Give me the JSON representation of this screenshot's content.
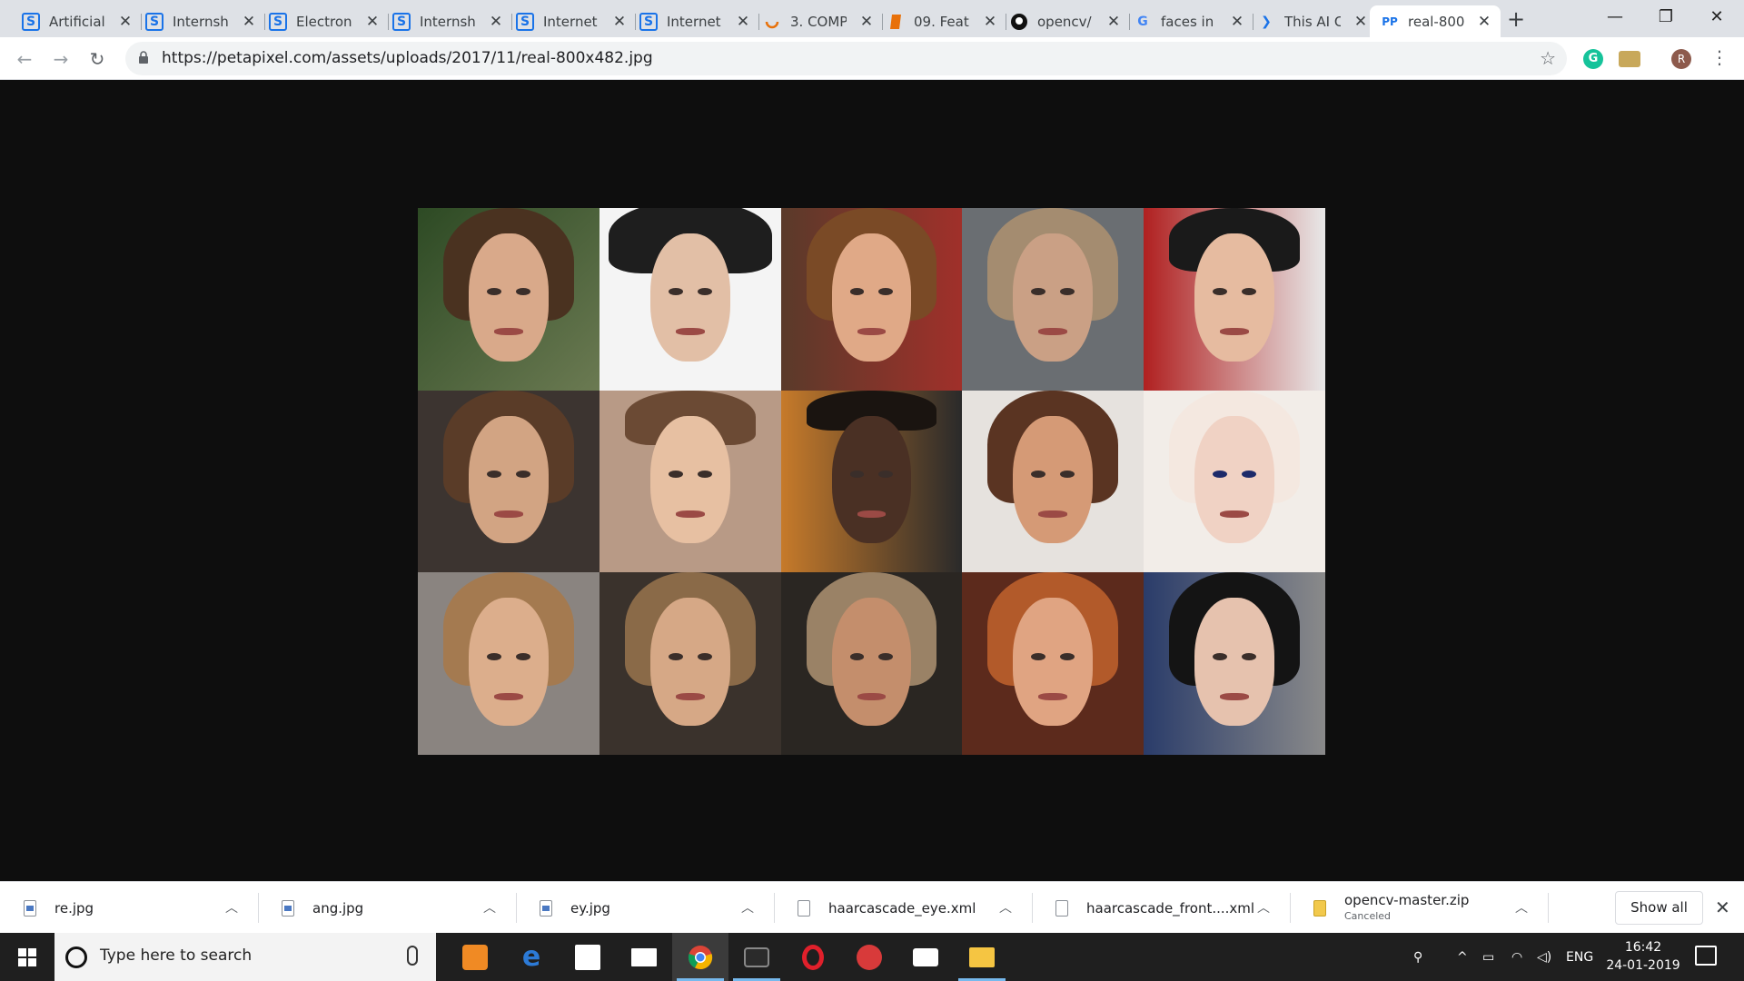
{
  "browser": {
    "tabs": [
      {
        "title": "Artificial",
        "favicon": "slideshare-icon"
      },
      {
        "title": "Internship",
        "favicon": "slideshare-icon"
      },
      {
        "title": "Electronic",
        "favicon": "slideshare-icon"
      },
      {
        "title": "Internship",
        "favicon": "slideshare-icon"
      },
      {
        "title": "Internet",
        "favicon": "slideshare-icon"
      },
      {
        "title": "Internet",
        "favicon": "slideshare-icon"
      },
      {
        "title": "3. COMP",
        "favicon": "loading-spinner-icon"
      },
      {
        "title": "09. Feat",
        "favicon": "document-icon"
      },
      {
        "title": "opencv/",
        "favicon": "github-icon"
      },
      {
        "title": "faces in",
        "favicon": "google-icon"
      },
      {
        "title": "This AI C",
        "favicon": "chevron-icon"
      },
      {
        "title": "real-800",
        "favicon": "petapixel-icon",
        "active": true
      }
    ],
    "new_tab_label": "+",
    "address": {
      "url": "https://petapixel.com/assets/uploads/2017/11/real-800x482.jpg"
    },
    "profile_initial": "R",
    "grammarly_letter": "G"
  },
  "downloads": {
    "items": [
      {
        "name": "re.jpg",
        "status": "",
        "type": "image"
      },
      {
        "name": "ang.jpg",
        "status": "",
        "type": "image"
      },
      {
        "name": "ey.jpg",
        "status": "",
        "type": "image"
      },
      {
        "name": "haarcascade_eye.xml",
        "status": "",
        "type": "xml"
      },
      {
        "name": "haarcascade_front....xml",
        "status": "",
        "type": "xml"
      },
      {
        "name": "opencv-master.zip",
        "status": "Canceled",
        "type": "zip"
      }
    ],
    "show_all_label": "Show all"
  },
  "taskbar": {
    "search_placeholder": "Type here to search",
    "language": "ENG",
    "time": "16:42",
    "date": "24-01-2019"
  },
  "colors": {
    "tab_strip": "#dee1e6",
    "page_background": "#0e0e0e",
    "taskbar": "#1f1f1f",
    "accent_blue": "#1a73e8"
  }
}
